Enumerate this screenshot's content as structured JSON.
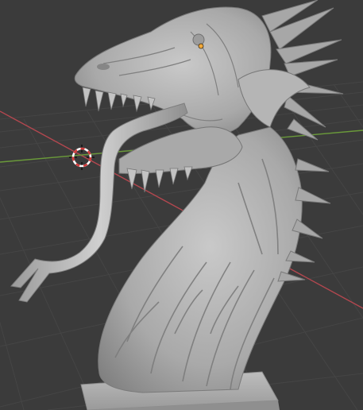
{
  "viewport": {
    "background_color": "#3b3b3b",
    "grid_color": "#474747",
    "x_axis_color": "#b3474f",
    "y_axis_color": "#6a9a3a",
    "model_color": "#b8b8b8",
    "model_shadow_color": "#7a7a7a",
    "origin_color": "#f2a93a",
    "cursor_icon": "3d-cursor-icon",
    "model_name": "dragon-sculpt"
  }
}
